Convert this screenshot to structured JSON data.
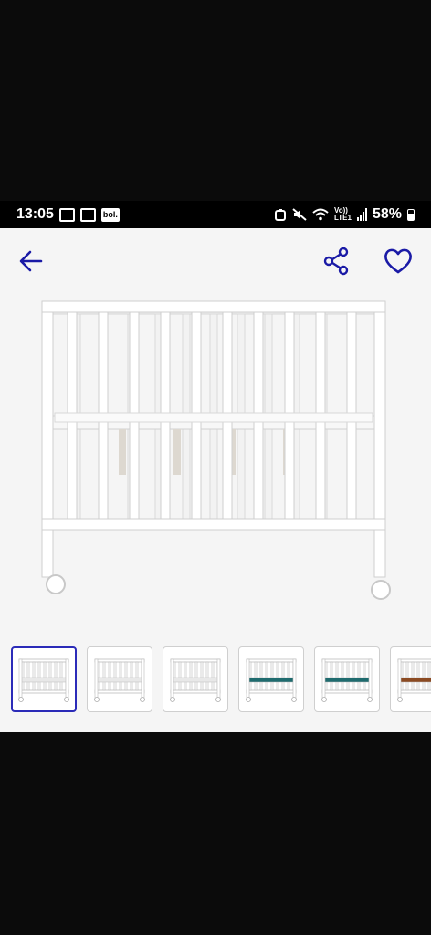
{
  "status_bar": {
    "time": "13:05",
    "bol_badge": "bol.",
    "network_label": "Vo))",
    "lte_label": "LTE1",
    "battery": "58%"
  },
  "toolbar": {
    "back_icon": "arrow-left-icon",
    "share_icon": "share-icon",
    "favorite_icon": "heart-icon",
    "accent_color": "#1a1aa6"
  },
  "product": {
    "image_icon": "baby-crib-image"
  },
  "thumbnails": {
    "selected_index": 0,
    "mattress_colors": [
      "#ffffff",
      "#ffffff",
      "#ffffff",
      "#1f6b6e",
      "#1f6b6e",
      "#8b4a22"
    ]
  }
}
